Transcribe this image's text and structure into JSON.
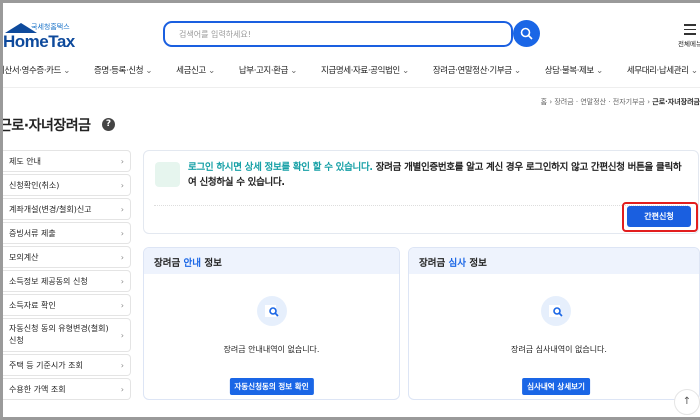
{
  "header": {
    "logo_sub": "국세청홈택스",
    "logo_main": "HomeTax",
    "search_placeholder": "검색어를 입력하세요!",
    "menu_label": "전체메뉴"
  },
  "nav": [
    "계산서·영수증·카드",
    "증명·등록·신청",
    "세금신고",
    "납부·고지·환급",
    "지급명세·자료·공익법인",
    "장려금·연말정산·기부금",
    "상담·불복·제보",
    "세무대리·납세관리"
  ],
  "breadcrumb": {
    "home": "홈",
    "l1": "장려금 · 연말정산 · 전자기부금",
    "current": "근로·자녀장려금"
  },
  "title": "근로·자녀장려금",
  "sidebar": [
    "제도 안내",
    "신청확인(취소)",
    "계좌개설(변경/철회)신고",
    "증빙서류 제출",
    "모의계산",
    "소득정보 제공동의 신청",
    "소득자료 확인",
    "자동신청 동의 유형변경(철회) 신청",
    "주택 등 기준시가 조회",
    "수용한 가액 조회"
  ],
  "info": {
    "highlight": "로그인 하시면 상세 정보를 확인 할 수 있습니다.",
    "text": " 장려금 개별인증번호를 알고 계신 경우 로그인하지 않고 간편신청 버튼을 클릭하여 신청하실 수 있습니다.",
    "button": "간편신청"
  },
  "cards": [
    {
      "pre": "장려금 ",
      "bold": "안내",
      "post": " 정보",
      "message": "장려금 안내내역이 없습니다.",
      "button": "자동신청동의 정보 확인"
    },
    {
      "pre": "장려금 ",
      "bold": "심사",
      "post": " 정보",
      "message": "장려금 심사내역이 없습니다.",
      "button": "심사내역 상세보기"
    }
  ],
  "colors": {
    "primary": "#1a66e6",
    "highlight": "#16a0a6",
    "outline": "#e21e1e"
  }
}
